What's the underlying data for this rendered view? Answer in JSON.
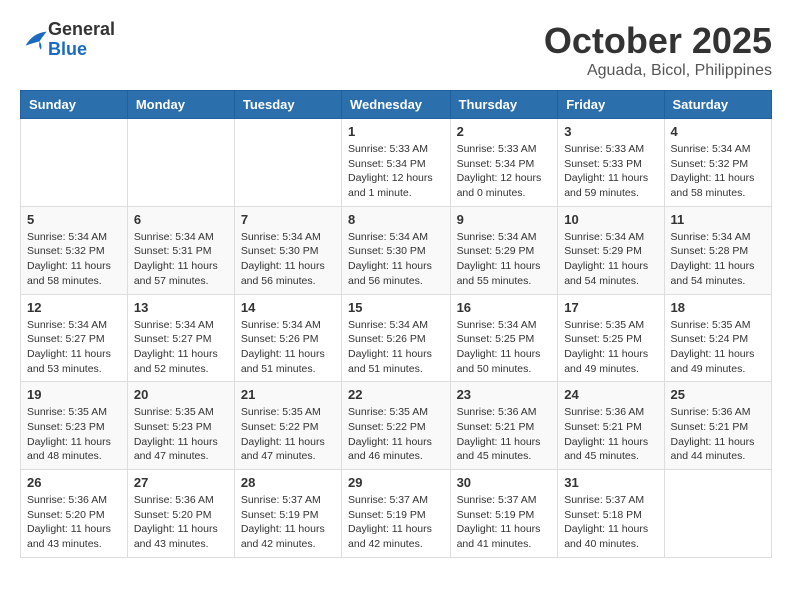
{
  "header": {
    "logo_general": "General",
    "logo_blue": "Blue",
    "month": "October 2025",
    "location": "Aguada, Bicol, Philippines"
  },
  "weekdays": [
    "Sunday",
    "Monday",
    "Tuesday",
    "Wednesday",
    "Thursday",
    "Friday",
    "Saturday"
  ],
  "weeks": [
    [
      {
        "day": "",
        "info": ""
      },
      {
        "day": "",
        "info": ""
      },
      {
        "day": "",
        "info": ""
      },
      {
        "day": "1",
        "info": "Sunrise: 5:33 AM\nSunset: 5:34 PM\nDaylight: 12 hours\nand 1 minute."
      },
      {
        "day": "2",
        "info": "Sunrise: 5:33 AM\nSunset: 5:34 PM\nDaylight: 12 hours\nand 0 minutes."
      },
      {
        "day": "3",
        "info": "Sunrise: 5:33 AM\nSunset: 5:33 PM\nDaylight: 11 hours\nand 59 minutes."
      },
      {
        "day": "4",
        "info": "Sunrise: 5:34 AM\nSunset: 5:32 PM\nDaylight: 11 hours\nand 58 minutes."
      }
    ],
    [
      {
        "day": "5",
        "info": "Sunrise: 5:34 AM\nSunset: 5:32 PM\nDaylight: 11 hours\nand 58 minutes."
      },
      {
        "day": "6",
        "info": "Sunrise: 5:34 AM\nSunset: 5:31 PM\nDaylight: 11 hours\nand 57 minutes."
      },
      {
        "day": "7",
        "info": "Sunrise: 5:34 AM\nSunset: 5:30 PM\nDaylight: 11 hours\nand 56 minutes."
      },
      {
        "day": "8",
        "info": "Sunrise: 5:34 AM\nSunset: 5:30 PM\nDaylight: 11 hours\nand 56 minutes."
      },
      {
        "day": "9",
        "info": "Sunrise: 5:34 AM\nSunset: 5:29 PM\nDaylight: 11 hours\nand 55 minutes."
      },
      {
        "day": "10",
        "info": "Sunrise: 5:34 AM\nSunset: 5:29 PM\nDaylight: 11 hours\nand 54 minutes."
      },
      {
        "day": "11",
        "info": "Sunrise: 5:34 AM\nSunset: 5:28 PM\nDaylight: 11 hours\nand 54 minutes."
      }
    ],
    [
      {
        "day": "12",
        "info": "Sunrise: 5:34 AM\nSunset: 5:27 PM\nDaylight: 11 hours\nand 53 minutes."
      },
      {
        "day": "13",
        "info": "Sunrise: 5:34 AM\nSunset: 5:27 PM\nDaylight: 11 hours\nand 52 minutes."
      },
      {
        "day": "14",
        "info": "Sunrise: 5:34 AM\nSunset: 5:26 PM\nDaylight: 11 hours\nand 51 minutes."
      },
      {
        "day": "15",
        "info": "Sunrise: 5:34 AM\nSunset: 5:26 PM\nDaylight: 11 hours\nand 51 minutes."
      },
      {
        "day": "16",
        "info": "Sunrise: 5:34 AM\nSunset: 5:25 PM\nDaylight: 11 hours\nand 50 minutes."
      },
      {
        "day": "17",
        "info": "Sunrise: 5:35 AM\nSunset: 5:25 PM\nDaylight: 11 hours\nand 49 minutes."
      },
      {
        "day": "18",
        "info": "Sunrise: 5:35 AM\nSunset: 5:24 PM\nDaylight: 11 hours\nand 49 minutes."
      }
    ],
    [
      {
        "day": "19",
        "info": "Sunrise: 5:35 AM\nSunset: 5:23 PM\nDaylight: 11 hours\nand 48 minutes."
      },
      {
        "day": "20",
        "info": "Sunrise: 5:35 AM\nSunset: 5:23 PM\nDaylight: 11 hours\nand 47 minutes."
      },
      {
        "day": "21",
        "info": "Sunrise: 5:35 AM\nSunset: 5:22 PM\nDaylight: 11 hours\nand 47 minutes."
      },
      {
        "day": "22",
        "info": "Sunrise: 5:35 AM\nSunset: 5:22 PM\nDaylight: 11 hours\nand 46 minutes."
      },
      {
        "day": "23",
        "info": "Sunrise: 5:36 AM\nSunset: 5:21 PM\nDaylight: 11 hours\nand 45 minutes."
      },
      {
        "day": "24",
        "info": "Sunrise: 5:36 AM\nSunset: 5:21 PM\nDaylight: 11 hours\nand 45 minutes."
      },
      {
        "day": "25",
        "info": "Sunrise: 5:36 AM\nSunset: 5:21 PM\nDaylight: 11 hours\nand 44 minutes."
      }
    ],
    [
      {
        "day": "26",
        "info": "Sunrise: 5:36 AM\nSunset: 5:20 PM\nDaylight: 11 hours\nand 43 minutes."
      },
      {
        "day": "27",
        "info": "Sunrise: 5:36 AM\nSunset: 5:20 PM\nDaylight: 11 hours\nand 43 minutes."
      },
      {
        "day": "28",
        "info": "Sunrise: 5:37 AM\nSunset: 5:19 PM\nDaylight: 11 hours\nand 42 minutes."
      },
      {
        "day": "29",
        "info": "Sunrise: 5:37 AM\nSunset: 5:19 PM\nDaylight: 11 hours\nand 42 minutes."
      },
      {
        "day": "30",
        "info": "Sunrise: 5:37 AM\nSunset: 5:19 PM\nDaylight: 11 hours\nand 41 minutes."
      },
      {
        "day": "31",
        "info": "Sunrise: 5:37 AM\nSunset: 5:18 PM\nDaylight: 11 hours\nand 40 minutes."
      },
      {
        "day": "",
        "info": ""
      }
    ]
  ]
}
